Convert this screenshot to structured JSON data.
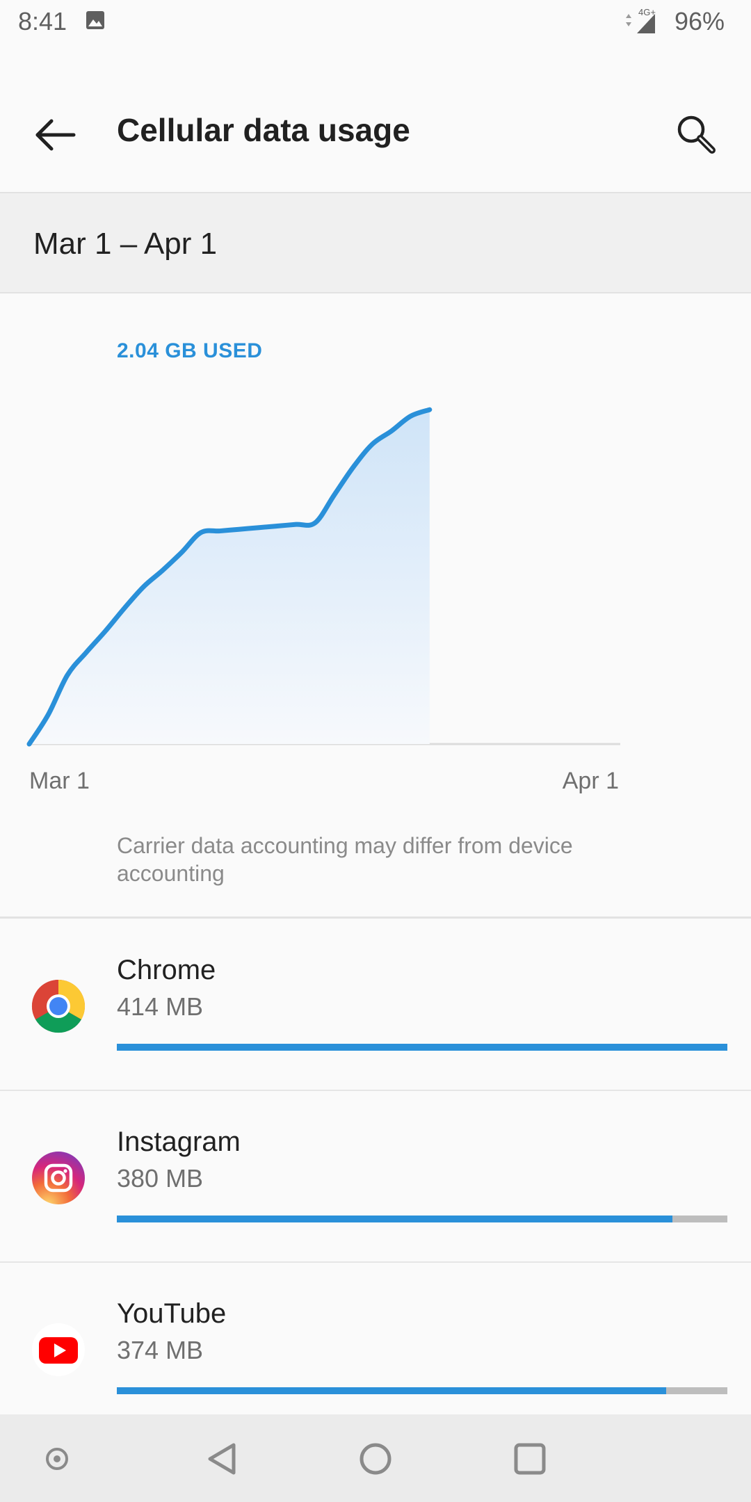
{
  "status_bar": {
    "time": "8:41",
    "network": "4G+",
    "battery": "96%"
  },
  "header": {
    "title": "Cellular data usage"
  },
  "date_range": "Mar 1 – Apr 1",
  "usage": {
    "total_label": "2.04 GB USED"
  },
  "chart_data": {
    "type": "area",
    "x_labels": [
      "Mar 1",
      "Apr 1"
    ],
    "x_days": [
      0,
      1,
      2,
      3,
      4,
      5,
      6,
      7,
      8,
      9,
      10,
      11,
      12,
      13,
      14,
      15,
      16,
      17,
      18,
      19,
      20,
      21
    ],
    "y_gb": [
      0.0,
      0.18,
      0.42,
      0.56,
      0.69,
      0.83,
      0.96,
      1.06,
      1.17,
      1.29,
      1.3,
      1.31,
      1.32,
      1.33,
      1.34,
      1.35,
      1.52,
      1.69,
      1.83,
      1.91,
      2.0,
      2.04
    ],
    "ylim": [
      0,
      2.1
    ],
    "x_range_days": [
      0,
      31
    ],
    "color": "#2a90d9",
    "grid": false
  },
  "disclaimer": "Carrier data accounting may differ from device accounting",
  "apps": [
    {
      "name": "Chrome",
      "size": "414 MB",
      "fraction": 1.0,
      "icon": "chrome-icon"
    },
    {
      "name": "Instagram",
      "size": "380 MB",
      "fraction": 0.91,
      "icon": "instagram-icon"
    },
    {
      "name": "YouTube",
      "size": "374 MB",
      "fraction": 0.9,
      "icon": "youtube-icon"
    }
  ]
}
